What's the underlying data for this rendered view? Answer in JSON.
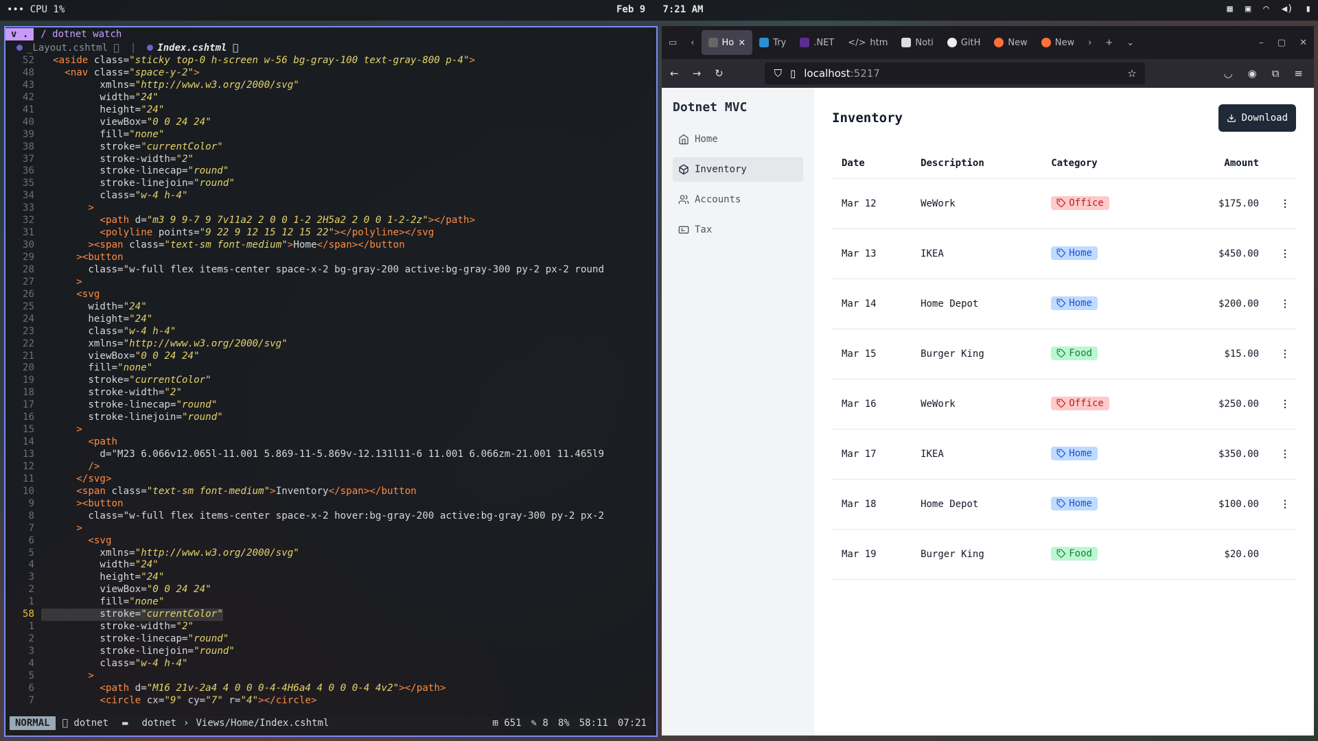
{
  "topbar": {
    "cpu": "••• CPU  1%",
    "date": "Feb 9",
    "time": "7:21 AM"
  },
  "terminal": {
    "mode": "v .",
    "path": "/ dotnet watch",
    "buffers": [
      {
        "label": "_Layout.cshtml 󰗦"
      },
      {
        "label": "Index.cshtml 󰗦"
      }
    ],
    "lines": [
      {
        "n": "52",
        "t": "  <aside class=\"sticky top-0 h-screen w-56 bg-gray-100 text-gray-800 p-4\">"
      },
      {
        "n": "48",
        "t": "    <nav class=\"space-y-2\">"
      },
      {
        "n": "43",
        "t": "          xmlns=\"http://www.w3.org/2000/svg\""
      },
      {
        "n": "42",
        "t": "          width=\"24\""
      },
      {
        "n": "41",
        "t": "          height=\"24\""
      },
      {
        "n": "40",
        "t": "          viewBox=\"0 0 24 24\""
      },
      {
        "n": "39",
        "t": "          fill=\"none\""
      },
      {
        "n": "38",
        "t": "          stroke=\"currentColor\""
      },
      {
        "n": "37",
        "t": "          stroke-width=\"2\""
      },
      {
        "n": "36",
        "t": "          stroke-linecap=\"round\""
      },
      {
        "n": "35",
        "t": "          stroke-linejoin=\"round\""
      },
      {
        "n": "34",
        "t": "          class=\"w-4 h-4\""
      },
      {
        "n": "33",
        "t": "        >"
      },
      {
        "n": "32",
        "t": "          <path d=\"m3 9 9-7 9 7v11a2 2 0 0 1-2 2H5a2 2 0 0 1-2-2z\"></path>"
      },
      {
        "n": "31",
        "t": "          <polyline points=\"9 22 9 12 15 12 15 22\"></polyline></svg"
      },
      {
        "n": "30",
        "t": "        ><span class=\"text-sm font-medium\">Home</span></button"
      },
      {
        "n": "29",
        "t": "      ><button"
      },
      {
        "n": "28",
        "t": "        class=\"w-full flex items-center space-x-2 bg-gray-200 active:bg-gray-300 py-2 px-2 round"
      },
      {
        "n": "27",
        "t": "      >"
      },
      {
        "n": "26",
        "t": "      <svg"
      },
      {
        "n": "25",
        "t": "        width=\"24\""
      },
      {
        "n": "24",
        "t": "        height=\"24\""
      },
      {
        "n": "23",
        "t": "        class=\"w-4 h-4\""
      },
      {
        "n": "22",
        "t": "        xmlns=\"http://www.w3.org/2000/svg\""
      },
      {
        "n": "21",
        "t": "        viewBox=\"0 0 24 24\""
      },
      {
        "n": "20",
        "t": "        fill=\"none\""
      },
      {
        "n": "19",
        "t": "        stroke=\"currentColor\""
      },
      {
        "n": "18",
        "t": "        stroke-width=\"2\""
      },
      {
        "n": "17",
        "t": "        stroke-linecap=\"round\""
      },
      {
        "n": "16",
        "t": "        stroke-linejoin=\"round\""
      },
      {
        "n": "15",
        "t": "      >"
      },
      {
        "n": "14",
        "t": "        <path"
      },
      {
        "n": "13",
        "t": "          d=\"M23 6.066v12.065l-11.001 5.869-11-5.869v-12.131l11-6 11.001 6.066zm-21.001 11.465l9"
      },
      {
        "n": "12",
        "t": "        />"
      },
      {
        "n": "11",
        "t": "      </svg>"
      },
      {
        "n": "10",
        "t": "      <span class=\"text-sm font-medium\">Inventory</span></button"
      },
      {
        "n": "9",
        "t": "      ><button"
      },
      {
        "n": "8",
        "t": "        class=\"w-full flex items-center space-x-2 hover:bg-gray-200 active:bg-gray-300 py-2 px-2"
      },
      {
        "n": "7",
        "t": "      >"
      },
      {
        "n": "6",
        "t": "        <svg"
      },
      {
        "n": "5",
        "t": "          xmlns=\"http://www.w3.org/2000/svg\""
      },
      {
        "n": "4",
        "t": "          width=\"24\""
      },
      {
        "n": "3",
        "t": "          height=\"24\""
      },
      {
        "n": "2",
        "t": "          viewBox=\"0 0 24 24\""
      },
      {
        "n": "1",
        "t": "          fill=\"none\""
      },
      {
        "n": "58",
        "t": "          stroke=\"currentColor\"",
        "cur": true
      },
      {
        "n": "1",
        "t": "          stroke-width=\"2\""
      },
      {
        "n": "2",
        "t": "          stroke-linecap=\"round\""
      },
      {
        "n": "3",
        "t": "          stroke-linejoin=\"round\""
      },
      {
        "n": "4",
        "t": "          class=\"w-4 h-4\""
      },
      {
        "n": "5",
        "t": "        >"
      },
      {
        "n": "6",
        "t": "          <path d=\"M16 21v-2a4 4 0 0 0-4-4H6a4 4 0 0 0-4 4v2\"></path>"
      },
      {
        "n": "7",
        "t": "          <circle cx=\"9\" cy=\"7\" r=\"4\"></circle>"
      }
    ],
    "status": {
      "mode": "NORMAL",
      "session": "󰆍 dotnet",
      "cwd": "dotnet",
      "file": "Views/Home/Index.cshtml",
      "added": "651",
      "changed": "8",
      "percent": "8%",
      "pos": "58:11",
      "time": "07:21"
    }
  },
  "browser": {
    "tabs": [
      {
        "label": "Ho"
      },
      {
        "label": "Try"
      },
      {
        "label": ".NET"
      },
      {
        "label": "htm"
      },
      {
        "label": "Noti"
      },
      {
        "label": "GitH"
      },
      {
        "label": "New"
      },
      {
        "label": "New"
      }
    ],
    "url_host": "localhost",
    "url_port": ":5217",
    "sidebar": {
      "brand": "Dotnet MVC",
      "items": [
        {
          "label": "Home",
          "icon": "home-icon"
        },
        {
          "label": "Inventory",
          "icon": "box-icon",
          "active": true
        },
        {
          "label": "Accounts",
          "icon": "users-icon"
        },
        {
          "label": "Tax",
          "icon": "receipt-icon"
        }
      ]
    },
    "main": {
      "title": "Inventory",
      "download_label": "Download",
      "columns": [
        "Date",
        "Description",
        "Category",
        "Amount"
      ],
      "rows": [
        {
          "date": "Mar 12",
          "desc": "WeWork",
          "cat": "Office",
          "amount": "$175.00"
        },
        {
          "date": "Mar 13",
          "desc": "IKEA",
          "cat": "Home",
          "amount": "$450.00"
        },
        {
          "date": "Mar 14",
          "desc": "Home Depot",
          "cat": "Home",
          "amount": "$200.00"
        },
        {
          "date": "Mar 15",
          "desc": "Burger King",
          "cat": "Food",
          "amount": "$15.00"
        },
        {
          "date": "Mar 16",
          "desc": "WeWork",
          "cat": "Office",
          "amount": "$250.00"
        },
        {
          "date": "Mar 17",
          "desc": "IKEA",
          "cat": "Home",
          "amount": "$350.00"
        },
        {
          "date": "Mar 18",
          "desc": "Home Depot",
          "cat": "Home",
          "amount": "$100.00"
        },
        {
          "date": "Mar 19",
          "desc": "Burger King",
          "cat": "Food",
          "amount": "$20.00"
        }
      ]
    }
  }
}
